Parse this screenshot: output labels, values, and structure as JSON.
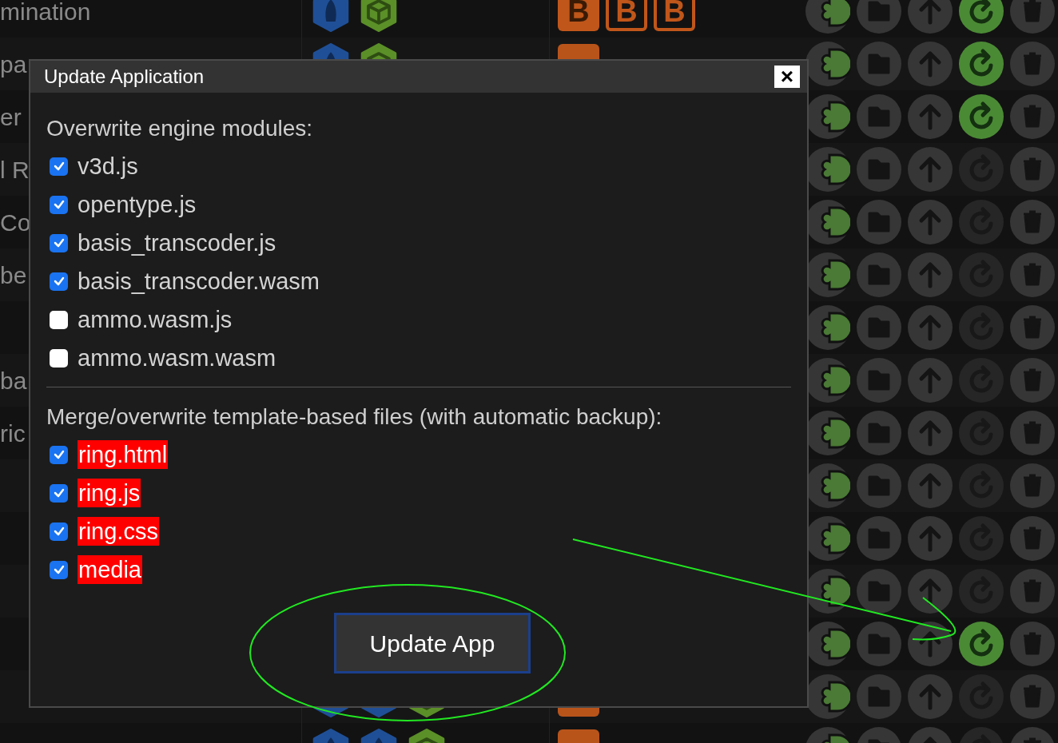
{
  "background": {
    "rows": [
      {
        "label": "mination",
        "badges": [
          "B",
          "B",
          "B"
        ],
        "update_active": true
      },
      {
        "label": "pa",
        "update_active": true
      },
      {
        "label": "er",
        "update_active": true
      },
      {
        "label": "l R",
        "update_active": false
      },
      {
        "label": "Co",
        "update_active": false
      },
      {
        "label": "be",
        "update_active": false
      },
      {
        "update_active": false
      },
      {
        "label": "ba",
        "update_active": false
      },
      {
        "label": "ric",
        "update_active": false
      },
      {
        "update_active": false
      },
      {
        "update_active": false
      },
      {
        "update_active": false
      },
      {
        "update_active": true
      },
      {
        "update_active": false
      },
      {
        "update_active": false
      }
    ]
  },
  "dialog": {
    "title": "Update Application",
    "close": "×",
    "sections": [
      {
        "heading": "Overwrite engine modules:",
        "items": [
          {
            "label": "v3d.js",
            "checked": true,
            "highlighted": false
          },
          {
            "label": "opentype.js",
            "checked": true,
            "highlighted": false
          },
          {
            "label": "basis_transcoder.js",
            "checked": true,
            "highlighted": false
          },
          {
            "label": "basis_transcoder.wasm",
            "checked": true,
            "highlighted": false
          },
          {
            "label": "ammo.wasm.js",
            "checked": false,
            "highlighted": false
          },
          {
            "label": "ammo.wasm.wasm",
            "checked": false,
            "highlighted": false
          }
        ]
      },
      {
        "heading": "Merge/overwrite template-based files (with automatic backup):",
        "items": [
          {
            "label": "ring.html",
            "checked": true,
            "highlighted": true
          },
          {
            "label": "ring.js",
            "checked": true,
            "highlighted": true
          },
          {
            "label": "ring.css",
            "checked": true,
            "highlighted": true
          },
          {
            "label": "media",
            "checked": true,
            "highlighted": true
          }
        ]
      }
    ],
    "button": "Update App"
  }
}
